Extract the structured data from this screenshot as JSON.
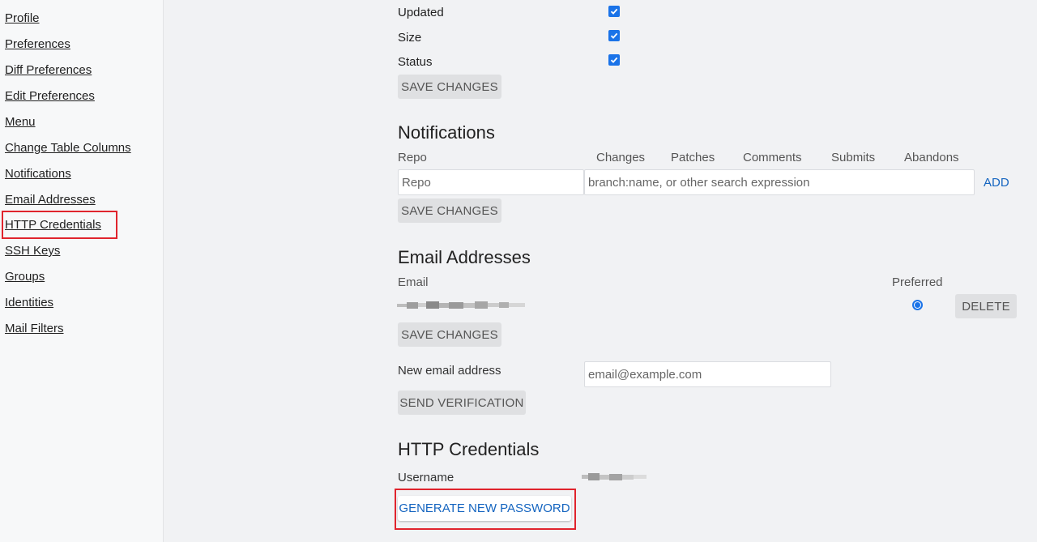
{
  "sidebar": {
    "items": [
      {
        "label": "Profile"
      },
      {
        "label": "Preferences"
      },
      {
        "label": "Diff Preferences"
      },
      {
        "label": "Edit Preferences"
      },
      {
        "label": "Menu"
      },
      {
        "label": "Change Table Columns"
      },
      {
        "label": "Notifications"
      },
      {
        "label": "Email Addresses"
      },
      {
        "label": "HTTP Credentials"
      },
      {
        "label": "SSH Keys"
      },
      {
        "label": "Groups"
      },
      {
        "label": "Identities"
      },
      {
        "label": "Mail Filters"
      }
    ]
  },
  "columns": {
    "rows": [
      {
        "label": "Updated",
        "checked": true
      },
      {
        "label": "Size",
        "checked": true
      },
      {
        "label": "Status",
        "checked": true
      }
    ],
    "save_label": "SAVE CHANGES"
  },
  "notifications": {
    "title": "Notifications",
    "headers": [
      "Repo",
      "Changes",
      "Patches",
      "Comments",
      "Submits",
      "Abandons"
    ],
    "repo_placeholder": "Repo",
    "filter_placeholder": "branch:name, or other search expression",
    "add_label": "ADD",
    "save_label": "SAVE CHANGES"
  },
  "email": {
    "title": "Email Addresses",
    "email_header": "Email",
    "preferred_header": "Preferred",
    "preferred_selected": true,
    "delete_label": "DELETE",
    "save_label": "SAVE CHANGES",
    "new_label": "New email address",
    "new_placeholder": "email@example.com",
    "send_label": "SEND VERIFICATION"
  },
  "http": {
    "title": "HTTP Credentials",
    "username_label": "Username",
    "generate_label": "GENERATE NEW PASSWORD"
  },
  "colors": {
    "accent": "#1a73e8",
    "link": "#1565c0",
    "highlight": "#e0242d"
  }
}
